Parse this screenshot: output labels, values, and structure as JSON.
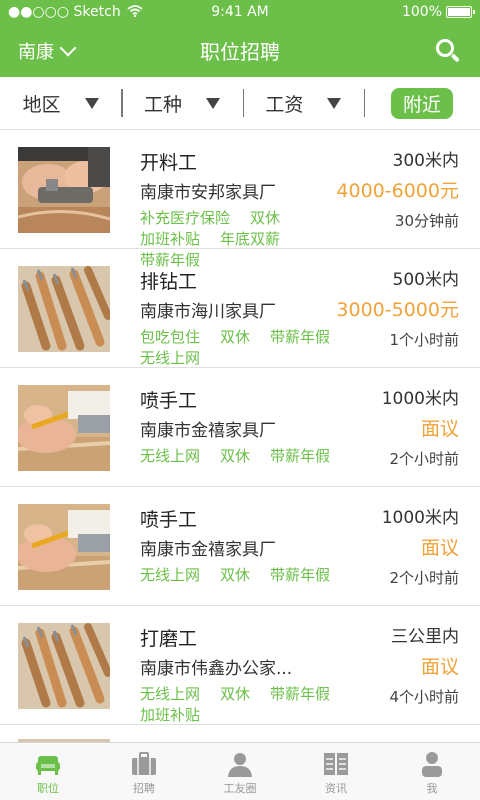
{
  "status_bar": {
    "carrier": "●●○○○ Sketch",
    "time": "9:41 AM",
    "battery": "100%"
  },
  "header": {
    "city": "南康",
    "title": "职位招聘"
  },
  "filters": [
    {
      "label": "地区"
    },
    {
      "label": "工种"
    },
    {
      "label": "工资"
    }
  ],
  "near_label": "附近",
  "jobs": [
    {
      "title": "开料工",
      "company": "南康市安邦家具厂",
      "distance": "300米内",
      "salary": "4000-6000元",
      "time": "30分钟前",
      "tags": [
        "补充医疗保险",
        "双休",
        "加班补贴",
        "年底双薪",
        "带薪年假"
      ],
      "thumb": "planer"
    },
    {
      "title": "排钻工",
      "company": "南康市海川家具厂",
      "distance": "500米内",
      "salary": "3000-5000元",
      "time": "1个小时前",
      "tags": [
        "包吃包住",
        "双休",
        "带薪年假",
        "无线上网"
      ],
      "thumb": "chisels"
    },
    {
      "title": "喷手工",
      "company": "南康市金禧家具厂",
      "distance": "1000米内",
      "salary": "面议",
      "time": "2个小时前",
      "tags": [
        "无线上网",
        "双休",
        "带薪年假"
      ],
      "thumb": "pencil"
    },
    {
      "title": "喷手工",
      "company": "南康市金禧家具厂",
      "distance": "1000米内",
      "salary": "面议",
      "time": "2个小时前",
      "tags": [
        "无线上网",
        "双休",
        "带薪年假"
      ],
      "thumb": "pencil"
    },
    {
      "title": "打磨工",
      "company": "南康市伟鑫办公家...",
      "distance": "三公里内",
      "salary": "面议",
      "time": "4个小时前",
      "tags": [
        "无线上网",
        "双休",
        "带薪年假",
        "加班补贴"
      ],
      "thumb": "chisels"
    }
  ],
  "tabs": [
    {
      "label": "职位",
      "icon": "couch-icon",
      "active": true
    },
    {
      "label": "招聘",
      "icon": "briefcase-icon",
      "active": false
    },
    {
      "label": "工友圈",
      "icon": "person-icon",
      "active": false
    },
    {
      "label": "资讯",
      "icon": "book-icon",
      "active": false
    },
    {
      "label": "我",
      "icon": "user-icon",
      "active": false
    }
  ],
  "colors": {
    "brand": "#6cc04a",
    "salary": "#f0a33a"
  }
}
